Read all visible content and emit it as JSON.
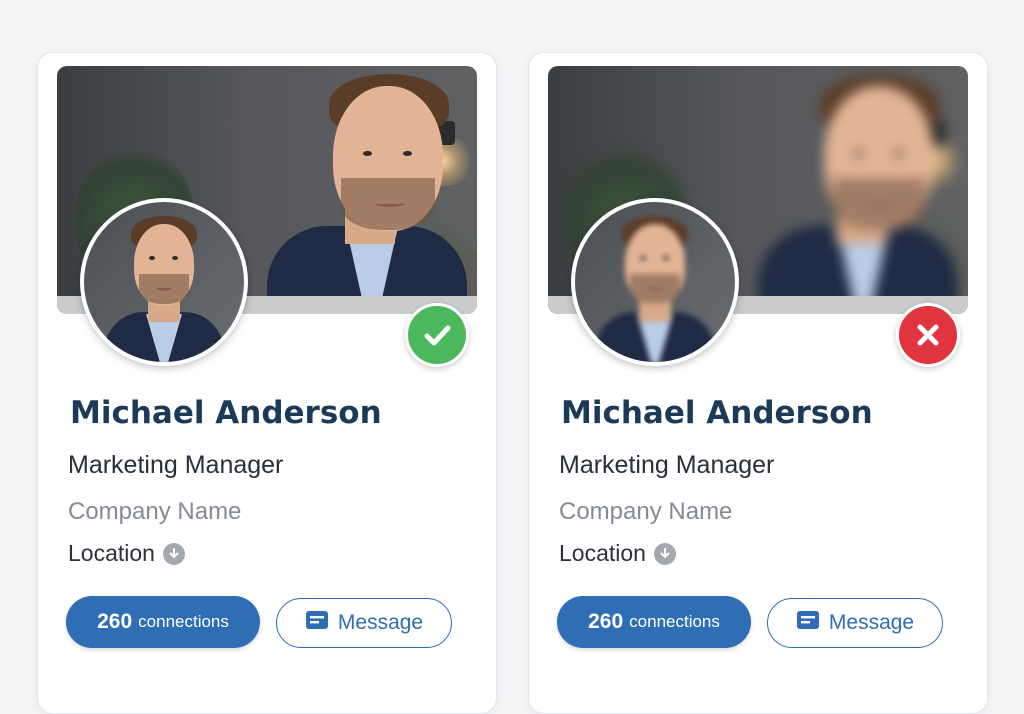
{
  "colors": {
    "name": "#1b3a57",
    "accent": "#2f6db4",
    "good": "#4cb85c",
    "bad": "#e0353f",
    "muted": "#868b91"
  },
  "cards": [
    {
      "photo_quality": "sharp",
      "status_icon": "check-icon",
      "name": "Michael Anderson",
      "title": "Marketing Manager",
      "company": "Company Name",
      "location": "Location",
      "connections_count": "260",
      "connections_label": "connections",
      "message_label": "Message"
    },
    {
      "photo_quality": "blurred",
      "status_icon": "x-icon",
      "name": "Michael Anderson",
      "title": "Marketing Manager",
      "company": "Company Name",
      "location": "Location",
      "connections_count": "260",
      "connections_label": "connections",
      "message_label": "Message"
    }
  ]
}
